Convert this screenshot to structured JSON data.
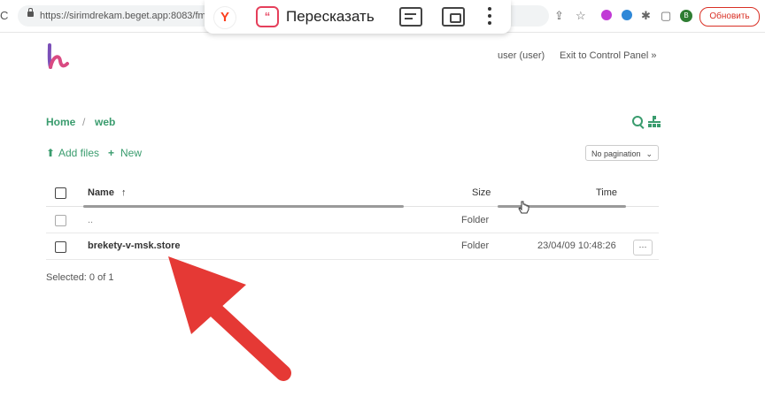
{
  "browser": {
    "url": "https://sirimdrekam.beget.app:8083/fm/#",
    "update_button": "Обновить",
    "profile_initial": "B"
  },
  "overlay": {
    "retell_label": "Пересказать"
  },
  "header": {
    "user": "user (user)",
    "exit": "Exit to Control Panel »"
  },
  "breadcrumb": {
    "home": "Home",
    "separator": "/",
    "current": "web"
  },
  "actions": {
    "add_files": "Add files",
    "new": "New",
    "pagination": "No pagination"
  },
  "table": {
    "headers": {
      "name": "Name",
      "size": "Size",
      "time": "Time"
    },
    "rows": [
      {
        "name": "..",
        "size": "Folder",
        "time": ""
      },
      {
        "name": "brekety-v-msk.store",
        "size": "Folder",
        "time": "23/04/09 10:48:26",
        "menu": "···"
      }
    ]
  },
  "status": {
    "selected": "Selected: 0 of 1"
  },
  "colors": {
    "accent": "#3a9c6e",
    "arrow": "#e53935"
  }
}
